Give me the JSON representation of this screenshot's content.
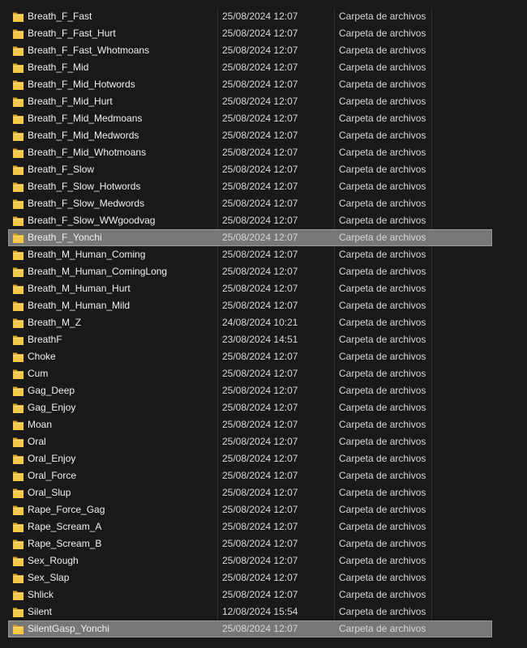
{
  "colors": {
    "background": "#191919",
    "text": "#f0f0f0",
    "selection": "#777777",
    "folder": "#f2c94c"
  },
  "files": [
    {
      "name": "Breath_F_Fast",
      "date": "25/08/2024 12:07",
      "type": "Carpeta de archivos"
    },
    {
      "name": "Breath_F_Fast_Hurt",
      "date": "25/08/2024 12:07",
      "type": "Carpeta de archivos"
    },
    {
      "name": "Breath_F_Fast_Whotmoans",
      "date": "25/08/2024 12:07",
      "type": "Carpeta de archivos"
    },
    {
      "name": "Breath_F_Mid",
      "date": "25/08/2024 12:07",
      "type": "Carpeta de archivos"
    },
    {
      "name": "Breath_F_Mid_Hotwords",
      "date": "25/08/2024 12:07",
      "type": "Carpeta de archivos"
    },
    {
      "name": "Breath_F_Mid_Hurt",
      "date": "25/08/2024 12:07",
      "type": "Carpeta de archivos"
    },
    {
      "name": "Breath_F_Mid_Medmoans",
      "date": "25/08/2024 12:07",
      "type": "Carpeta de archivos"
    },
    {
      "name": "Breath_F_Mid_Medwords",
      "date": "25/08/2024 12:07",
      "type": "Carpeta de archivos"
    },
    {
      "name": "Breath_F_Mid_Whotmoans",
      "date": "25/08/2024 12:07",
      "type": "Carpeta de archivos"
    },
    {
      "name": "Breath_F_Slow",
      "date": "25/08/2024 12:07",
      "type": "Carpeta de archivos"
    },
    {
      "name": "Breath_F_Slow_Hotwords",
      "date": "25/08/2024 12:07",
      "type": "Carpeta de archivos"
    },
    {
      "name": "Breath_F_Slow_Medwords",
      "date": "25/08/2024 12:07",
      "type": "Carpeta de archivos"
    },
    {
      "name": "Breath_F_Slow_WWgoodvag",
      "date": "25/08/2024 12:07",
      "type": "Carpeta de archivos"
    },
    {
      "name": "Breath_F_Yonchi",
      "date": "25/08/2024 12:07",
      "type": "Carpeta de archivos",
      "selected": true
    },
    {
      "name": "Breath_M_Human_Coming",
      "date": "25/08/2024 12:07",
      "type": "Carpeta de archivos"
    },
    {
      "name": "Breath_M_Human_ComingLong",
      "date": "25/08/2024 12:07",
      "type": "Carpeta de archivos"
    },
    {
      "name": "Breath_M_Human_Hurt",
      "date": "25/08/2024 12:07",
      "type": "Carpeta de archivos"
    },
    {
      "name": "Breath_M_Human_Mild",
      "date": "25/08/2024 12:07",
      "type": "Carpeta de archivos"
    },
    {
      "name": "Breath_M_Z",
      "date": "24/08/2024 10:21",
      "type": "Carpeta de archivos"
    },
    {
      "name": "BreathF",
      "date": "23/08/2024 14:51",
      "type": "Carpeta de archivos"
    },
    {
      "name": "Choke",
      "date": "25/08/2024 12:07",
      "type": "Carpeta de archivos"
    },
    {
      "name": "Cum",
      "date": "25/08/2024 12:07",
      "type": "Carpeta de archivos"
    },
    {
      "name": "Gag_Deep",
      "date": "25/08/2024 12:07",
      "type": "Carpeta de archivos"
    },
    {
      "name": "Gag_Enjoy",
      "date": "25/08/2024 12:07",
      "type": "Carpeta de archivos"
    },
    {
      "name": "Moan",
      "date": "25/08/2024 12:07",
      "type": "Carpeta de archivos"
    },
    {
      "name": "Oral",
      "date": "25/08/2024 12:07",
      "type": "Carpeta de archivos"
    },
    {
      "name": "Oral_Enjoy",
      "date": "25/08/2024 12:07",
      "type": "Carpeta de archivos"
    },
    {
      "name": "Oral_Force",
      "date": "25/08/2024 12:07",
      "type": "Carpeta de archivos"
    },
    {
      "name": "Oral_Slup",
      "date": "25/08/2024 12:07",
      "type": "Carpeta de archivos"
    },
    {
      "name": "Rape_Force_Gag",
      "date": "25/08/2024 12:07",
      "type": "Carpeta de archivos"
    },
    {
      "name": "Rape_Scream_A",
      "date": "25/08/2024 12:07",
      "type": "Carpeta de archivos"
    },
    {
      "name": "Rape_Scream_B",
      "date": "25/08/2024 12:07",
      "type": "Carpeta de archivos"
    },
    {
      "name": "Sex_Rough",
      "date": "25/08/2024 12:07",
      "type": "Carpeta de archivos"
    },
    {
      "name": "Sex_Slap",
      "date": "25/08/2024 12:07",
      "type": "Carpeta de archivos"
    },
    {
      "name": "Shlick",
      "date": "25/08/2024 12:07",
      "type": "Carpeta de archivos"
    },
    {
      "name": "Silent",
      "date": "12/08/2024 15:54",
      "type": "Carpeta de archivos"
    },
    {
      "name": "SilentGasp_Yonchi",
      "date": "25/08/2024 12:07",
      "type": "Carpeta de archivos",
      "selected": true
    }
  ]
}
